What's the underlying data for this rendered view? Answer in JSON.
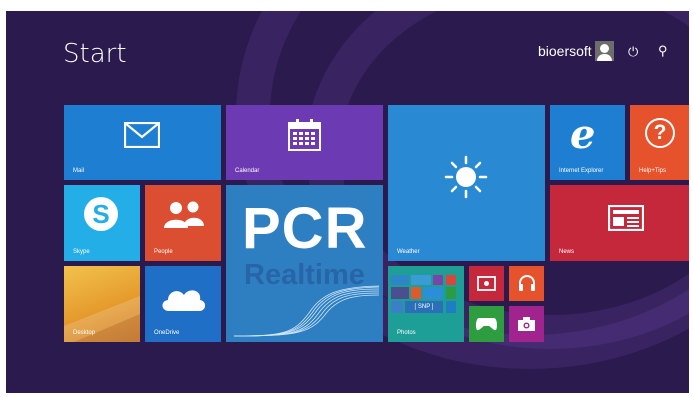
{
  "header": {
    "title": "Start",
    "user_name": "bioersoft",
    "power_glyph": "⏻",
    "search_glyph": "⚲"
  },
  "tiles": {
    "mail": {
      "label": "Mail",
      "color": "#1e7fd2"
    },
    "calendar": {
      "label": "Calendar",
      "color": "#6c3ab3"
    },
    "weather": {
      "label": "Weather",
      "color": "#2a89d3"
    },
    "ie": {
      "label": "Internet Explorer",
      "glyph": "e",
      "color": "#1e7fd2"
    },
    "help": {
      "label": "Help+Tips",
      "glyph": "?",
      "color": "#e6522c"
    },
    "skype": {
      "label": "Skype",
      "glyph": "S",
      "color": "#23aee7"
    },
    "people": {
      "label": "People",
      "color": "#dc4e31"
    },
    "news": {
      "label": "News",
      "color": "#c5283a"
    },
    "pcr": {
      "title": "PCR",
      "subtitle": "Realtime",
      "color": "#2e7fc1"
    },
    "desktop": {
      "label": "Desktop",
      "color": "#e59b2c"
    },
    "onedrive": {
      "label": "OneDrive",
      "color": "#1e6fc5"
    },
    "photos": {
      "label": "Photos",
      "color": "#1d9e97",
      "snapshot_label": "[ SNP ]"
    },
    "video": {
      "color": "#c5283a"
    },
    "music": {
      "color": "#e6522c"
    },
    "games": {
      "color": "#2e9d3f"
    },
    "camera": {
      "color": "#a1248e"
    }
  }
}
